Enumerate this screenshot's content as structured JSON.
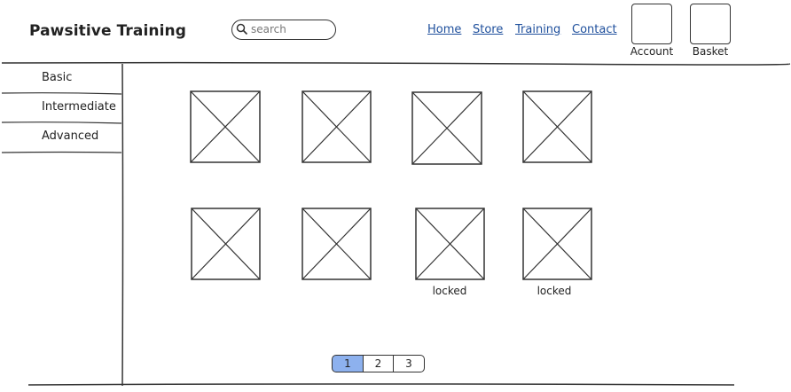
{
  "header": {
    "logo": "Pawsitive Training",
    "search_placeholder": "search",
    "nav": [
      "Home",
      "Store",
      "Training",
      "Contact"
    ],
    "account_label": "Account",
    "basket_label": "Basket"
  },
  "sidebar": {
    "items": [
      "Basic",
      "Intermediate",
      "Advanced"
    ]
  },
  "grid": {
    "rows": 2,
    "columns": 4,
    "locked_label": "locked",
    "locked_items": [
      7,
      8
    ]
  },
  "pagination": {
    "pages": [
      "1",
      "2",
      "3"
    ],
    "active": "1"
  }
}
